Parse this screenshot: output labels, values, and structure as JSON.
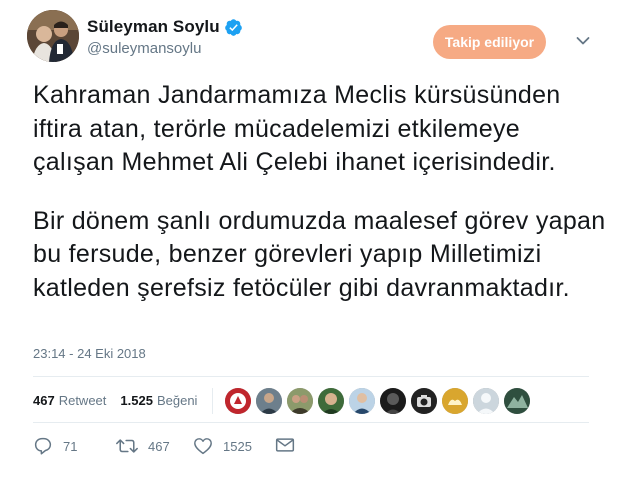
{
  "user": {
    "display_name": "Süleyman Soylu",
    "handle": "@suleymansoylu",
    "verified_icon": "verified-badge-icon"
  },
  "header": {
    "follow_label": "Takip ediliyor",
    "more_icon": "chevron-down-icon"
  },
  "tweet": {
    "paragraphs": [
      "Kahraman Jandarmamıza Meclis kürsüsünden iftira atan, terörle mücadelemizi etkilemeye çalışan Mehmet Ali Çelebi ihanet içerisindedir.",
      "Bir dönem şanlı ordumuzda maalesef görev yapan bu fersude, benzer görevleri yapıp Milletimizi katleden şerefsiz fetöcüler gibi davranmaktadır."
    ],
    "timestamp": "23:14 - 24 Eki 2018"
  },
  "stats": {
    "retweet_count": "467",
    "retweet_label": "Retweet",
    "like_count": "1.525",
    "like_label": "Beğeni"
  },
  "actions": {
    "reply_count": "71",
    "retweet_count": "467",
    "like_count": "1525"
  },
  "colors": {
    "follow_button_bg": "#f6aa84",
    "verified_blue": "#1da1f2",
    "secondary_text": "#657786"
  }
}
